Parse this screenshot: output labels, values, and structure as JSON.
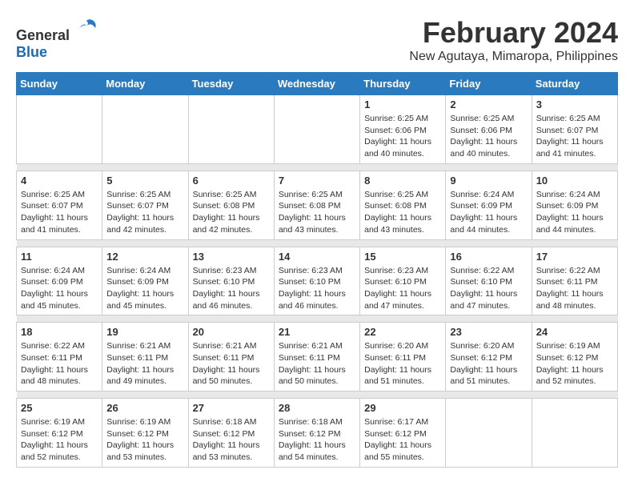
{
  "logo": {
    "general": "General",
    "blue": "Blue"
  },
  "title": "February 2024",
  "subtitle": "New Agutaya, Mimaropa, Philippines",
  "days_header": [
    "Sunday",
    "Monday",
    "Tuesday",
    "Wednesday",
    "Thursday",
    "Friday",
    "Saturday"
  ],
  "weeks": [
    {
      "cells": [
        {
          "day": "",
          "text": ""
        },
        {
          "day": "",
          "text": ""
        },
        {
          "day": "",
          "text": ""
        },
        {
          "day": "",
          "text": ""
        },
        {
          "day": "1",
          "text": "Sunrise: 6:25 AM\nSunset: 6:06 PM\nDaylight: 11 hours and 40 minutes."
        },
        {
          "day": "2",
          "text": "Sunrise: 6:25 AM\nSunset: 6:06 PM\nDaylight: 11 hours and 40 minutes."
        },
        {
          "day": "3",
          "text": "Sunrise: 6:25 AM\nSunset: 6:07 PM\nDaylight: 11 hours and 41 minutes."
        }
      ]
    },
    {
      "cells": [
        {
          "day": "4",
          "text": "Sunrise: 6:25 AM\nSunset: 6:07 PM\nDaylight: 11 hours and 41 minutes."
        },
        {
          "day": "5",
          "text": "Sunrise: 6:25 AM\nSunset: 6:07 PM\nDaylight: 11 hours and 42 minutes."
        },
        {
          "day": "6",
          "text": "Sunrise: 6:25 AM\nSunset: 6:08 PM\nDaylight: 11 hours and 42 minutes."
        },
        {
          "day": "7",
          "text": "Sunrise: 6:25 AM\nSunset: 6:08 PM\nDaylight: 11 hours and 43 minutes."
        },
        {
          "day": "8",
          "text": "Sunrise: 6:25 AM\nSunset: 6:08 PM\nDaylight: 11 hours and 43 minutes."
        },
        {
          "day": "9",
          "text": "Sunrise: 6:24 AM\nSunset: 6:09 PM\nDaylight: 11 hours and 44 minutes."
        },
        {
          "day": "10",
          "text": "Sunrise: 6:24 AM\nSunset: 6:09 PM\nDaylight: 11 hours and 44 minutes."
        }
      ]
    },
    {
      "cells": [
        {
          "day": "11",
          "text": "Sunrise: 6:24 AM\nSunset: 6:09 PM\nDaylight: 11 hours and 45 minutes."
        },
        {
          "day": "12",
          "text": "Sunrise: 6:24 AM\nSunset: 6:09 PM\nDaylight: 11 hours and 45 minutes."
        },
        {
          "day": "13",
          "text": "Sunrise: 6:23 AM\nSunset: 6:10 PM\nDaylight: 11 hours and 46 minutes."
        },
        {
          "day": "14",
          "text": "Sunrise: 6:23 AM\nSunset: 6:10 PM\nDaylight: 11 hours and 46 minutes."
        },
        {
          "day": "15",
          "text": "Sunrise: 6:23 AM\nSunset: 6:10 PM\nDaylight: 11 hours and 47 minutes."
        },
        {
          "day": "16",
          "text": "Sunrise: 6:22 AM\nSunset: 6:10 PM\nDaylight: 11 hours and 47 minutes."
        },
        {
          "day": "17",
          "text": "Sunrise: 6:22 AM\nSunset: 6:11 PM\nDaylight: 11 hours and 48 minutes."
        }
      ]
    },
    {
      "cells": [
        {
          "day": "18",
          "text": "Sunrise: 6:22 AM\nSunset: 6:11 PM\nDaylight: 11 hours and 48 minutes."
        },
        {
          "day": "19",
          "text": "Sunrise: 6:21 AM\nSunset: 6:11 PM\nDaylight: 11 hours and 49 minutes."
        },
        {
          "day": "20",
          "text": "Sunrise: 6:21 AM\nSunset: 6:11 PM\nDaylight: 11 hours and 50 minutes."
        },
        {
          "day": "21",
          "text": "Sunrise: 6:21 AM\nSunset: 6:11 PM\nDaylight: 11 hours and 50 minutes."
        },
        {
          "day": "22",
          "text": "Sunrise: 6:20 AM\nSunset: 6:11 PM\nDaylight: 11 hours and 51 minutes."
        },
        {
          "day": "23",
          "text": "Sunrise: 6:20 AM\nSunset: 6:12 PM\nDaylight: 11 hours and 51 minutes."
        },
        {
          "day": "24",
          "text": "Sunrise: 6:19 AM\nSunset: 6:12 PM\nDaylight: 11 hours and 52 minutes."
        }
      ]
    },
    {
      "cells": [
        {
          "day": "25",
          "text": "Sunrise: 6:19 AM\nSunset: 6:12 PM\nDaylight: 11 hours and 52 minutes."
        },
        {
          "day": "26",
          "text": "Sunrise: 6:19 AM\nSunset: 6:12 PM\nDaylight: 11 hours and 53 minutes."
        },
        {
          "day": "27",
          "text": "Sunrise: 6:18 AM\nSunset: 6:12 PM\nDaylight: 11 hours and 53 minutes."
        },
        {
          "day": "28",
          "text": "Sunrise: 6:18 AM\nSunset: 6:12 PM\nDaylight: 11 hours and 54 minutes."
        },
        {
          "day": "29",
          "text": "Sunrise: 6:17 AM\nSunset: 6:12 PM\nDaylight: 11 hours and 55 minutes."
        },
        {
          "day": "",
          "text": ""
        },
        {
          "day": "",
          "text": ""
        }
      ]
    }
  ]
}
